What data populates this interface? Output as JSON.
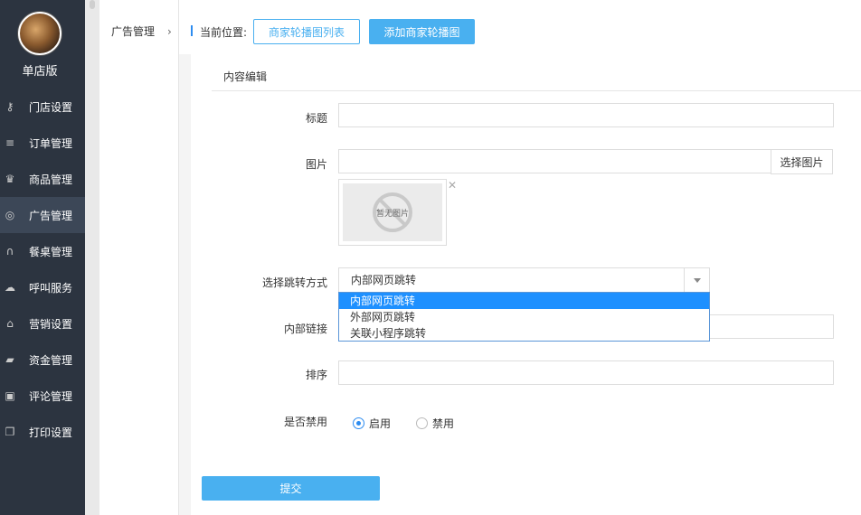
{
  "sidebar": {
    "shop_name": "单店版",
    "items": [
      {
        "icon": "key-icon",
        "glyph": "⚷",
        "label": "门店设置"
      },
      {
        "icon": "list-icon",
        "glyph": "≡",
        "label": "订单管理"
      },
      {
        "icon": "trophy-icon",
        "glyph": "♛",
        "label": "商品管理"
      },
      {
        "icon": "globe-icon",
        "glyph": "◎",
        "label": "广告管理"
      },
      {
        "icon": "binoculars-icon",
        "glyph": "∩",
        "label": "餐桌管理"
      },
      {
        "icon": "cloud-icon",
        "glyph": "☁",
        "label": "呼叫服务"
      },
      {
        "icon": "gift-icon",
        "glyph": "⌂",
        "label": "营销设置"
      },
      {
        "icon": "book-icon",
        "glyph": "▰",
        "label": "资金管理"
      },
      {
        "icon": "money-icon",
        "glyph": "▣",
        "label": "评论管理"
      },
      {
        "icon": "copy-icon",
        "glyph": "❐",
        "label": "打印设置"
      }
    ],
    "active_index": 3
  },
  "subnav": {
    "label": "广告管理",
    "chevron": "›"
  },
  "topbar": {
    "location_label": "当前位置:",
    "list_button": "商家轮播图列表",
    "add_button": "添加商家轮播图"
  },
  "panel": {
    "heading": "内容编辑",
    "fields": {
      "title_label": "标题",
      "title_value": "",
      "image_label": "图片",
      "image_value": "",
      "image_pick_button": "选择图片",
      "image_placeholder_text": "暂无图片",
      "image_close": "✕",
      "jump_label": "选择跳转方式",
      "jump_value": "内部网页跳转",
      "jump_options": [
        "内部网页跳转",
        "外部网页跳转",
        "关联小程序跳转"
      ],
      "link_label": "内部链接",
      "link_value": "",
      "sort_label": "排序",
      "sort_value": "",
      "disable_label": "是否禁用",
      "radio_enable": "启用",
      "radio_disable": "禁用",
      "selected_radio": "启用"
    },
    "submit_button": "提交"
  },
  "colors": {
    "sidebar_bg": "#2c3440",
    "accent": "#49b0f0",
    "dropdown_highlight": "#1e90ff"
  }
}
